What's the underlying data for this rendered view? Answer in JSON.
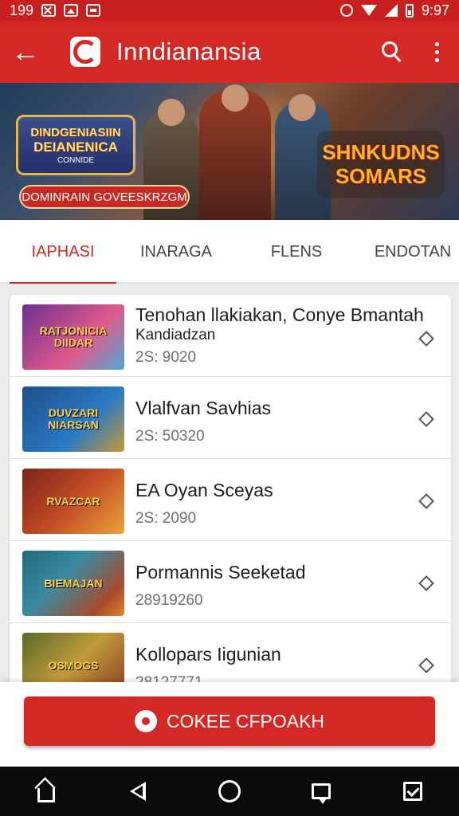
{
  "status_bar": {
    "left_text": "199",
    "time": "9:97"
  },
  "app_bar": {
    "title": "Inndianansia"
  },
  "banner": {
    "left_badge_line1": "DINDGENIASIIN",
    "left_badge_line2": "DEIANENICA",
    "left_badge_small": "CONNIDE",
    "pill_text": "DOMINRAIN GOVEESKRZGM",
    "right_badge_line1": "SHNKUDNS",
    "right_badge_line2": "SOMARS"
  },
  "tabs": [
    {
      "label": "IAPHASI",
      "active": true
    },
    {
      "label": "INARAGA",
      "active": false
    },
    {
      "label": "FLENS",
      "active": false
    },
    {
      "label": "ENDOTAN",
      "active": false
    }
  ],
  "items": [
    {
      "title": "Tenohan llakiakan, Conye Bmantah",
      "subtitle": "Kandiadzan",
      "meta": "2S: 9020",
      "thumb_text": "RATJONICIA DIIDAR"
    },
    {
      "title": "Vlalfvan Savhias",
      "subtitle": "",
      "meta": "2S: 50320",
      "thumb_text": "DUVZARI NIARSAN"
    },
    {
      "title": "EA Oyan Sceyas",
      "subtitle": "",
      "meta": "2S: 2090",
      "thumb_text": "RVAZCAR"
    },
    {
      "title": "Pormannis Seeketad",
      "subtitle": "",
      "meta": "28919260",
      "thumb_text": "BIEMAJAN"
    },
    {
      "title": "Kollopars Iigunian",
      "subtitle": "",
      "meta": "28127771",
      "thumb_text": "OSMOGS"
    }
  ],
  "cta": {
    "label": "COKEE CFPOAKH"
  },
  "icons": {
    "back": "arrow-left-icon",
    "search": "search-icon",
    "more": "more-vert-icon",
    "row_action": "diamond-icon",
    "nav": [
      "home-icon",
      "back-triangle-icon",
      "circle-icon",
      "chat-icon",
      "checkbox-icon"
    ]
  },
  "colors": {
    "primary": "#d32824",
    "status_bar": "#c8201f",
    "nav_bar": "#0b0b0b"
  }
}
